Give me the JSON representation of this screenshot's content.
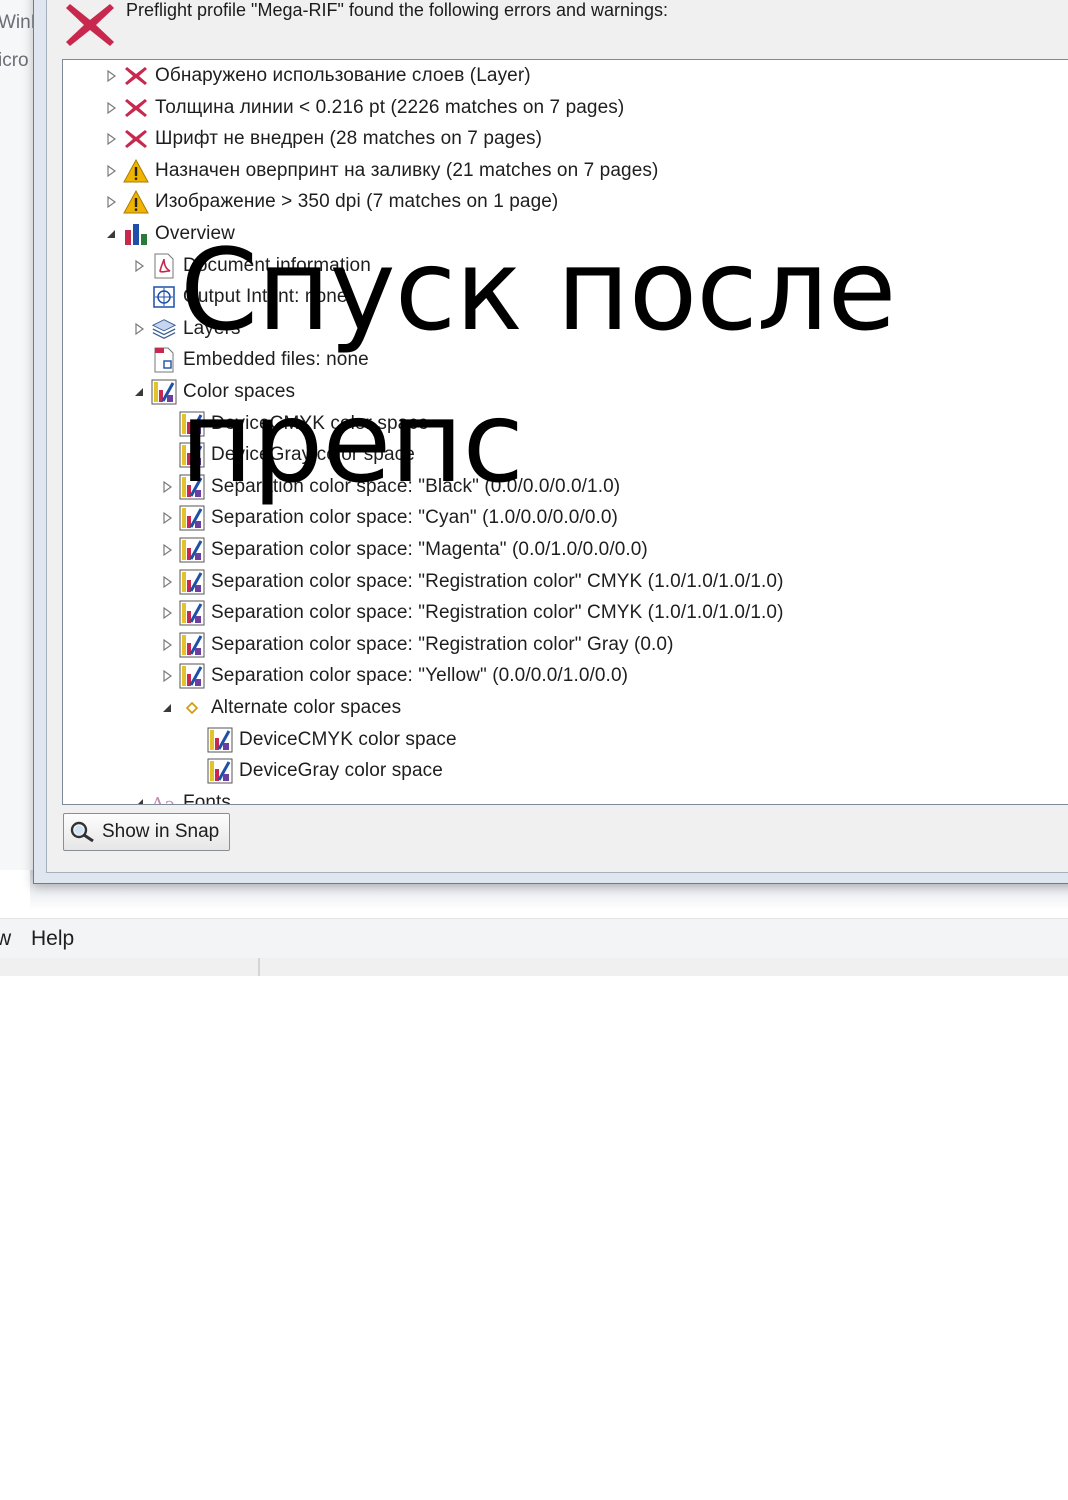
{
  "background_window": {
    "fragments": [
      "WinF",
      "icro"
    ]
  },
  "dialog": {
    "header": "Preflight profile \"Mega-RIF\" found the following errors and warnings:",
    "show_button": "Show in Snap"
  },
  "tree": [
    {
      "label": "Обнаружено использование слоев (Layer)",
      "icon": "error-x-icon",
      "expander": "collapsed"
    },
    {
      "label": "Толщина линии < 0.216 pt (2226 matches on 7 pages)",
      "icon": "error-x-icon",
      "expander": "collapsed"
    },
    {
      "label": "Шрифт не внедрен (28 matches on 7 pages)",
      "icon": "error-x-icon",
      "expander": "collapsed"
    },
    {
      "label": "Назначен оверпринт на заливку (21 matches on 7 pages)",
      "icon": "warning-icon",
      "expander": "collapsed"
    },
    {
      "label": "Изображение > 350 dpi (7 matches on 1 page)",
      "icon": "warning-icon",
      "expander": "collapsed"
    },
    {
      "label": "Overview",
      "icon": "overview-chart-icon",
      "expander": "expanded"
    },
    {
      "label": "Document information",
      "icon": "pdf-document-icon",
      "expander": "collapsed"
    },
    {
      "label": "Output Intent: none",
      "icon": "output-intent-icon",
      "expander": "none"
    },
    {
      "label": "Layers",
      "icon": "layers-icon",
      "expander": "collapsed"
    },
    {
      "label": "Embedded files: none",
      "icon": "embedded-file-icon",
      "expander": "none"
    },
    {
      "label": "Color spaces",
      "icon": "color-space-icon",
      "expander": "expanded"
    },
    {
      "label": "DeviceCMYK color space",
      "icon": "color-space-icon",
      "expander": "none"
    },
    {
      "label": "DeviceGray color space",
      "icon": "color-space-icon",
      "expander": "none"
    },
    {
      "label": "Separation color space: \"Black\"  (0.0/0.0/0.0/1.0)",
      "icon": "color-space-icon",
      "expander": "collapsed"
    },
    {
      "label": "Separation color space: \"Cyan\"  (1.0/0.0/0.0/0.0)",
      "icon": "color-space-icon",
      "expander": "collapsed"
    },
    {
      "label": "Separation color space: \"Magenta\"  (0.0/1.0/0.0/0.0)",
      "icon": "color-space-icon",
      "expander": "collapsed"
    },
    {
      "label": "Separation color space: \"Registration color\" CMYK (1.0/1.0/1.0/1.0)",
      "icon": "color-space-icon",
      "expander": "collapsed"
    },
    {
      "label": "Separation color space: \"Registration color\" CMYK (1.0/1.0/1.0/1.0)",
      "icon": "color-space-icon",
      "expander": "collapsed"
    },
    {
      "label": "Separation color space: \"Registration color\" Gray (0.0)",
      "icon": "color-space-icon",
      "expander": "collapsed"
    },
    {
      "label": "Separation color space: \"Yellow\"  (0.0/0.0/1.0/0.0)",
      "icon": "color-space-icon",
      "expander": "collapsed"
    },
    {
      "label": "Alternate color spaces",
      "icon": "diamond-bullet-icon",
      "expander": "expanded"
    },
    {
      "label": "DeviceCMYK color space",
      "icon": "color-space-icon",
      "expander": "none"
    },
    {
      "label": "DeviceGray color space",
      "icon": "color-space-icon",
      "expander": "none"
    },
    {
      "label": "Fonts",
      "icon": "fonts-icon",
      "expander": "expanded"
    }
  ],
  "menubar": {
    "left_fragment": "w",
    "help": "Help"
  },
  "overlay_text": {
    "line1": "Спуск после",
    "line2": "препс"
  },
  "colors": {
    "error": "#c8284e",
    "warning": "#f0b400",
    "tree_bg": "#ffffff",
    "dialog_bg": "#f0f0f0"
  }
}
